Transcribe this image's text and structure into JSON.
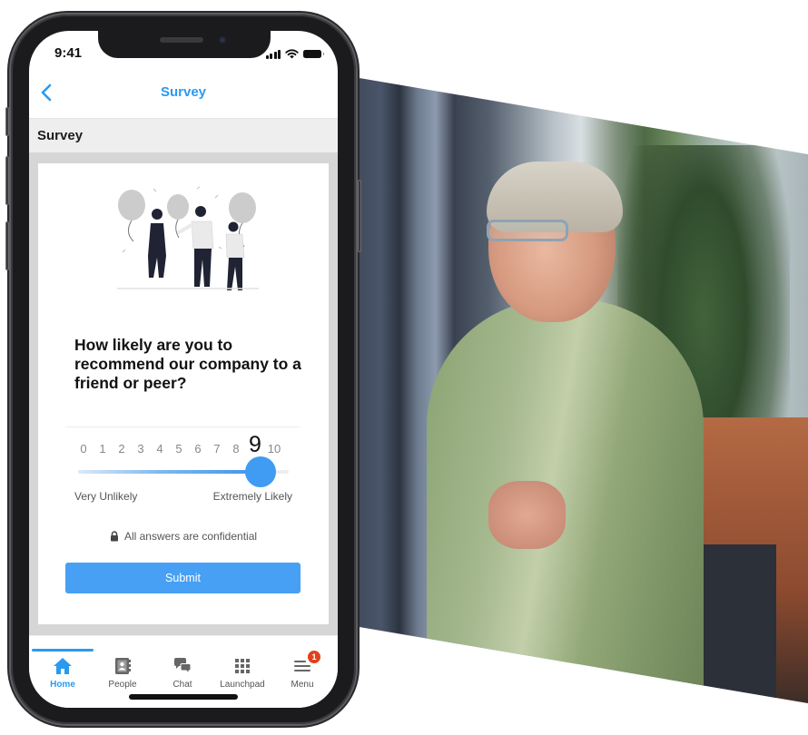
{
  "status_bar": {
    "time": "9:41",
    "icons": [
      "signal-icon",
      "wifi-icon",
      "battery-icon"
    ]
  },
  "nav": {
    "back_icon": "chevron-left-icon",
    "title": "Survey"
  },
  "section": {
    "title": "Survey"
  },
  "survey": {
    "illustration": "people-with-balloons-illustration",
    "question": "How likely are you to recommend our company to a friend or peer?",
    "scale": [
      "0",
      "1",
      "2",
      "3",
      "4",
      "5",
      "6",
      "7",
      "8",
      "9",
      "10"
    ],
    "selected_value": 9,
    "scale_min": 0,
    "scale_max": 10,
    "label_low": "Very Unlikely",
    "label_high": "Extremely Likely",
    "confidential_icon": "lock-icon",
    "confidential_text": "All answers are confidential",
    "submit_label": "Submit"
  },
  "tab_bar": {
    "tabs": [
      {
        "label": "Home",
        "icon": "home-icon",
        "active": true
      },
      {
        "label": "People",
        "icon": "contacts-book-icon",
        "active": false
      },
      {
        "label": "Chat",
        "icon": "chat-bubbles-icon",
        "active": false
      },
      {
        "label": "Launchpad",
        "icon": "grid-icon",
        "active": false
      },
      {
        "label": "Menu",
        "icon": "hamburger-menu-icon",
        "active": false,
        "badge": "1"
      }
    ]
  },
  "colors": {
    "accent": "#2a9af0",
    "button": "#47a0f4",
    "slider_thumb": "#3f9cf2",
    "badge": "#e1411e",
    "section_bg": "#eeeeee",
    "content_bg": "#d6d6d6"
  },
  "background_photo": {
    "subject": "woman-in-green-blouse-photo"
  }
}
